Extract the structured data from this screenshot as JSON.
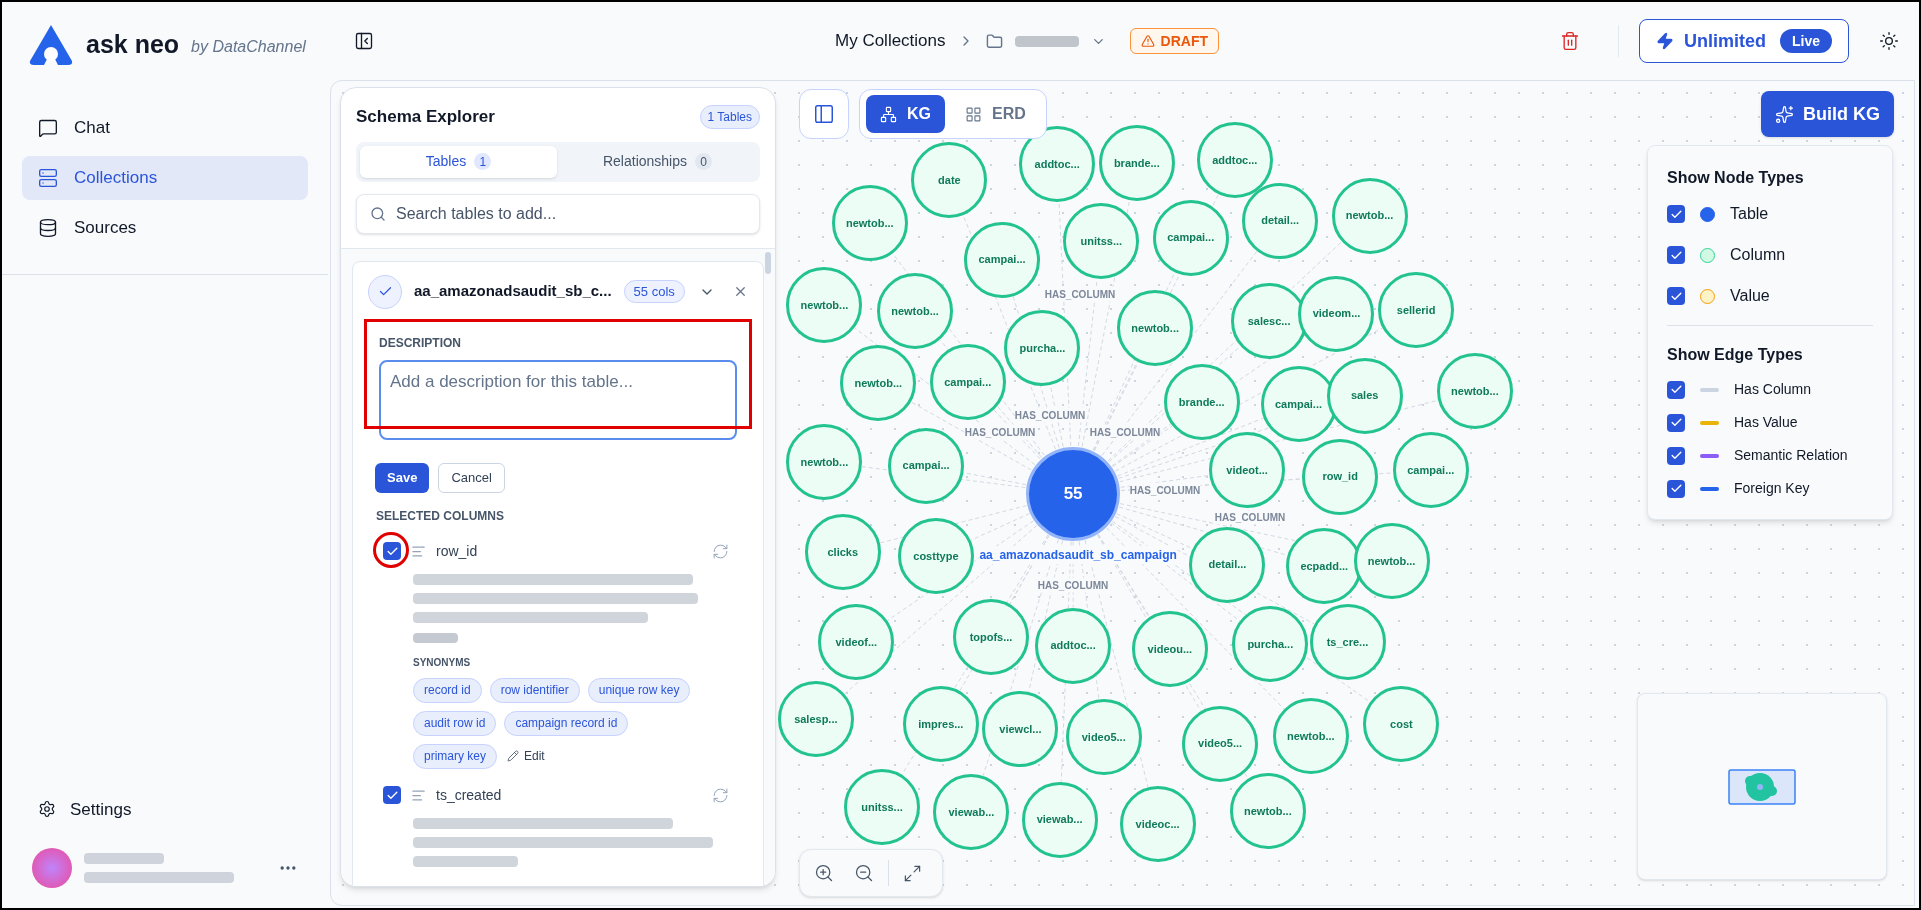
{
  "app": {
    "name": "ask neo",
    "byline": "by DataChannel"
  },
  "nav": [
    {
      "label": "Chat",
      "selected": false
    },
    {
      "label": "Collections",
      "selected": true
    },
    {
      "label": "Sources",
      "selected": false
    }
  ],
  "settings": "Settings",
  "header": {
    "breadcrumb": "My Collections",
    "status": "DRAFT",
    "plan": "Unlimited",
    "plan_badge": "Live"
  },
  "schema_explorer": {
    "title": "Schema Explorer",
    "count": "1 Tables",
    "tabs": [
      {
        "label": "Tables",
        "count": "1",
        "selected": true
      },
      {
        "label": "Relationships",
        "count": "0",
        "selected": false
      }
    ],
    "search": {
      "placeholder": "Search tables to add..."
    },
    "table": {
      "name": "aa_amazonadsaudit_sb_c...",
      "cols": "55 cols",
      "description_label": "DESCRIPTION",
      "description_placeholder": "Add a description for this table...",
      "buttons": [
        "Save",
        "Cancel"
      ],
      "columns_label": "SELECTED COLUMNS",
      "columns": [
        {
          "name": "row_id",
          "checked": true,
          "synonyms_label": "SYNONYMS",
          "synonyms": [
            "record id",
            "row identifier",
            "unique row key",
            "audit row id",
            "campaign record id",
            "primary key"
          ],
          "edit": "Edit"
        },
        {
          "name": "ts_created",
          "checked": true
        }
      ]
    }
  },
  "view_toggle": [
    {
      "label": "KG",
      "selected": true
    },
    {
      "label": "ERD",
      "selected": false
    }
  ],
  "build_button": "Build KG",
  "legend": {
    "node_title": "Show Node Types",
    "node_types": [
      {
        "label": "Table",
        "checked": true,
        "color": "#2563eb"
      },
      {
        "label": "Column",
        "checked": true,
        "color": "#d1fae5"
      },
      {
        "label": "Value",
        "checked": true,
        "color": "#fef3c7"
      }
    ],
    "edge_title": "Show Edge Types",
    "edge_types": [
      {
        "label": "Has Column",
        "checked": true,
        "color": "#cbd5e1"
      },
      {
        "label": "Has Value",
        "checked": true,
        "color": "#eab308"
      },
      {
        "label": "Semantic Relation",
        "checked": true,
        "color": "#8b5cf6"
      },
      {
        "label": "Foreign Key",
        "checked": true,
        "color": "#2563eb"
      }
    ]
  },
  "graph": {
    "center": {
      "count": "55",
      "label": "aa_amazonadsaudit_sb_campaign"
    },
    "nodes": [
      "date",
      "addtoc...",
      "brande...",
      "addtoc...",
      "newtob...",
      "campai...",
      "unitss...",
      "campai...",
      "detail...",
      "newtob...",
      "newtob...",
      "newtob...",
      "purcha...",
      "newtob...",
      "salesc...",
      "videom...",
      "sellerid",
      "newtob...",
      "campai...",
      "brande...",
      "campai...",
      "sales",
      "newtob...",
      "newtob...",
      "campai...",
      "videot...",
      "row_id",
      "campai...",
      "clicks",
      "costtype",
      "detail...",
      "ecpadd...",
      "newtob...",
      "videof...",
      "topofs...",
      "addtoc...",
      "videou...",
      "purcha...",
      "ts_cre...",
      "salesp...",
      "impres...",
      "viewcl...",
      "video5...",
      "video5...",
      "newtob...",
      "cost",
      "unitss...",
      "viewab...",
      "viewab...",
      "videoc...",
      "newtob..."
    ],
    "edge_labels": [
      "HAS_COLUMN",
      "HAS_COLUMN",
      "HAS_COLUMN",
      "HAS_COLUMN",
      "HAS_COLUMN",
      "HAS_COLUMN",
      "HAS_COLUMN"
    ]
  }
}
